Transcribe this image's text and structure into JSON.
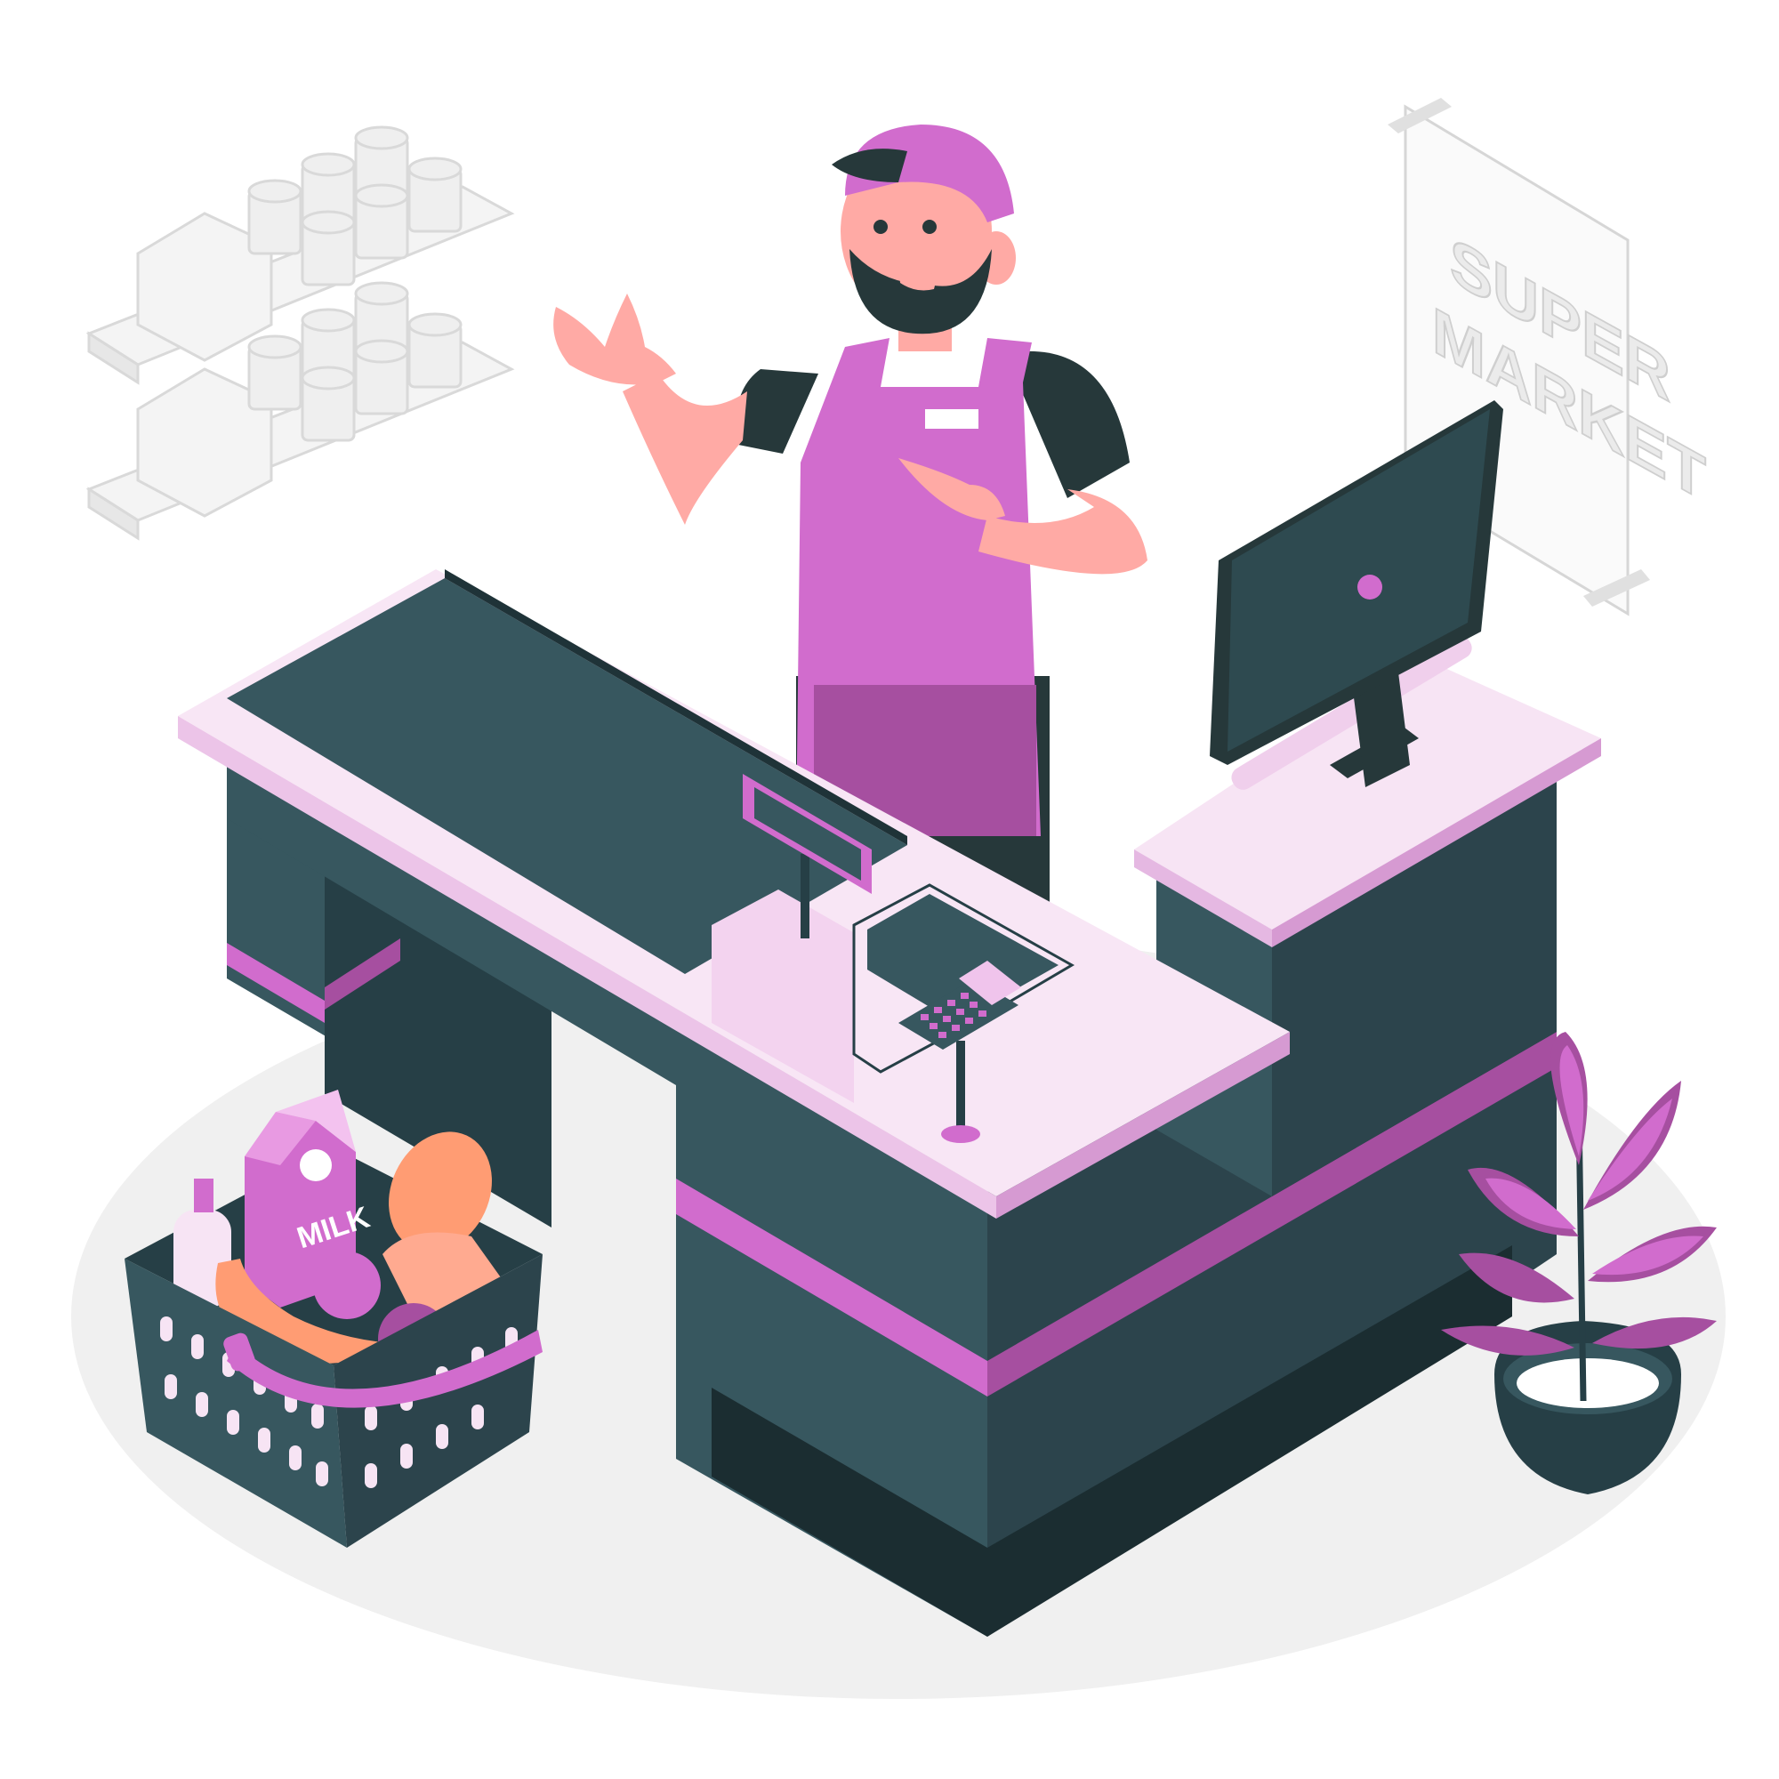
{
  "sign": {
    "line1": "SUPER",
    "line2": "MARKET"
  },
  "milk_carton": {
    "label": "MILK"
  },
  "colors": {
    "accent": "#d16ccd",
    "accent_dark": "#a64fa0",
    "counter_dark": "#37575f",
    "counter_darker": "#263f46",
    "counter_top": "#f7e4f4",
    "skin": "#ffaaa5",
    "hair": "#26383a"
  },
  "icons": [
    "cash-register-icon",
    "card-terminal-icon",
    "monitor-icon",
    "shopping-basket-icon",
    "potted-plant-icon"
  ]
}
